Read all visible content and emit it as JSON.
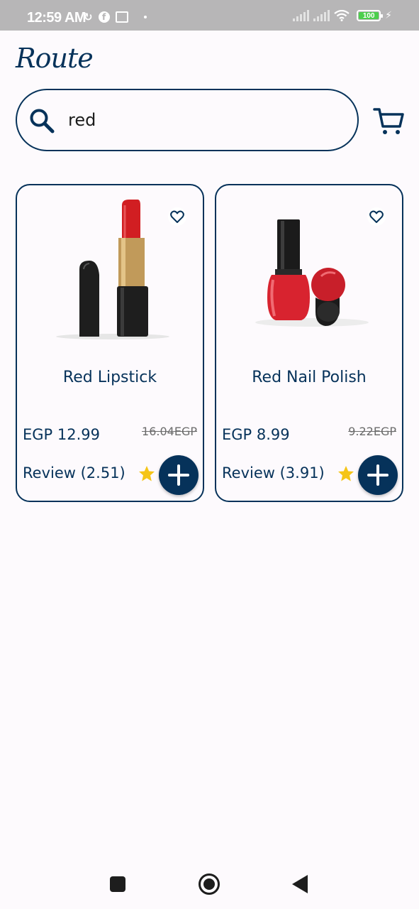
{
  "status_bar": {
    "time": "12:59",
    "ampm": "AM",
    "battery": "100",
    "icons": [
      "sync-icon",
      "facebook-icon",
      "gallery-icon",
      "dot-icon",
      "signal-icon",
      "signal-icon",
      "wifi-icon",
      "battery-icon",
      "charging-icon"
    ]
  },
  "header": {
    "logo": "Route"
  },
  "search": {
    "value": "red"
  },
  "products": [
    {
      "name": "Red Lipstick",
      "price": "EGP 12.99",
      "old_price": "16.04EGP",
      "review": "Review (2.51)"
    },
    {
      "name": "Red Nail Polish",
      "price": "EGP 8.99",
      "old_price": "9.22EGP",
      "review": "Review (3.91)"
    }
  ],
  "colors": {
    "primary": "#06325a",
    "star": "#f5c518",
    "background": "#fdfafd"
  }
}
